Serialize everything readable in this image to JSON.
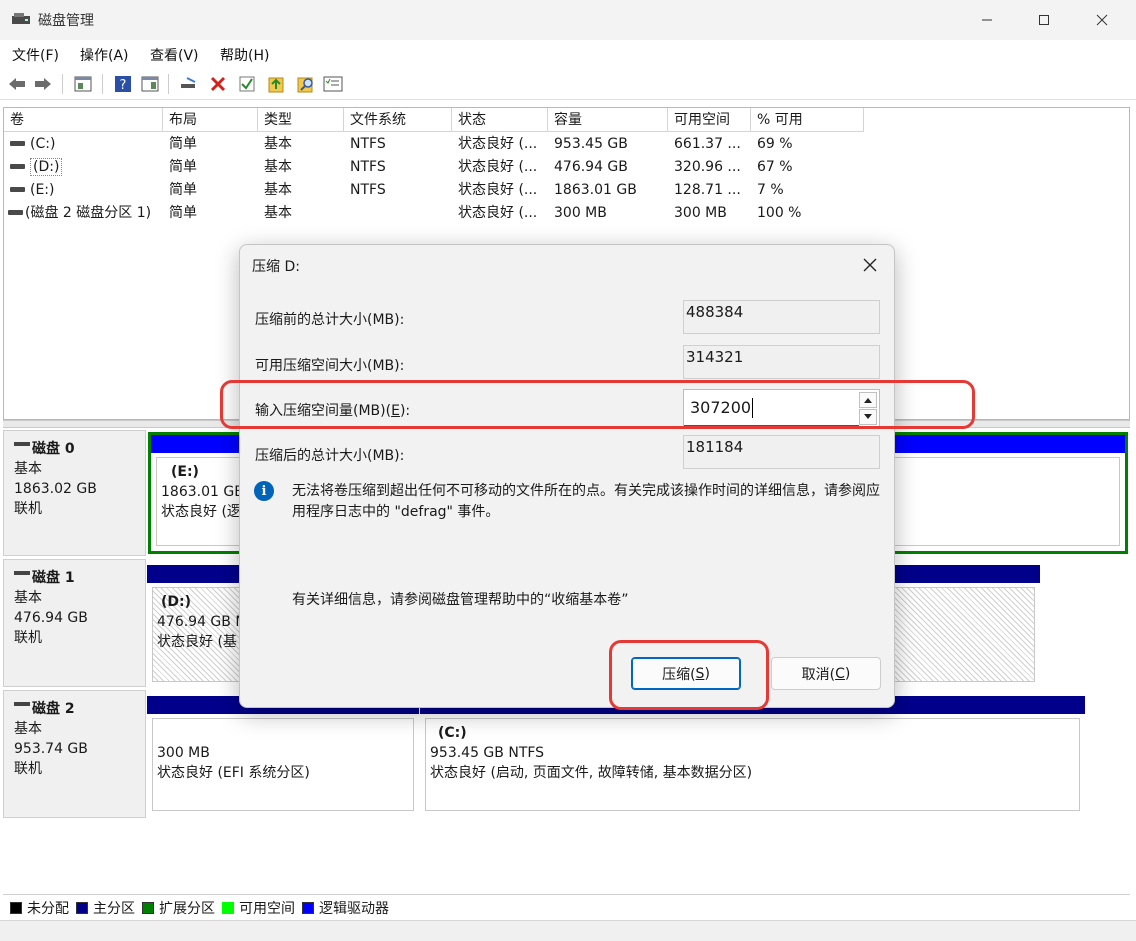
{
  "window": {
    "title": "磁盘管理"
  },
  "menu": [
    "文件(F)",
    "操作(A)",
    "查看(V)",
    "帮助(H)"
  ],
  "toolbar_icons": [
    "back-arrow-icon",
    "forward-arrow-icon",
    "console-tree-icon",
    "help-icon",
    "properties-icon",
    "connect-icon",
    "delete-icon",
    "check-icon",
    "import-icon",
    "search-icon",
    "list-icon"
  ],
  "volume_list": {
    "columns": [
      "卷",
      "布局",
      "类型",
      "文件系统",
      "状态",
      "容量",
      "可用空间",
      "% 可用"
    ],
    "rows": [
      [
        "(C:)",
        "简单",
        "基本",
        "NTFS",
        "状态良好 (...",
        "953.45 GB",
        "661.37 ...",
        "69 %"
      ],
      [
        "(D:)",
        "简单",
        "基本",
        "NTFS",
        "状态良好 (...",
        "476.94 GB",
        "320.96 ...",
        "67 %"
      ],
      [
        "(E:)",
        "简单",
        "基本",
        "NTFS",
        "状态良好 (...",
        "1863.01 GB",
        "128.71 ...",
        "7 %"
      ],
      [
        "(磁盘 2 磁盘分区 1)",
        "简单",
        "基本",
        "",
        "状态良好 (...",
        "300 MB",
        "300 MB",
        "100 %"
      ]
    ]
  },
  "disks": [
    {
      "name": "磁盘 0",
      "type": "基本",
      "size": "1863.02 GB",
      "status": "联机",
      "partitions": [
        {
          "name": "(E:)",
          "size": "1863.01 GE",
          "status": "状态良好 (逻"
        }
      ]
    },
    {
      "name": "磁盘 1",
      "type": "基本",
      "size": "476.94 GB",
      "status": "联机",
      "partitions": [
        {
          "name": "(D:)",
          "size": "476.94 GB N",
          "status": "状态良好 (基"
        }
      ]
    },
    {
      "name": "磁盘 2",
      "type": "基本",
      "size": "953.74 GB",
      "status": "联机",
      "partitions": [
        {
          "name": "",
          "size": "300 MB",
          "status": "状态良好 (EFI 系统分区)"
        },
        {
          "name": "(C:)",
          "size": "953.45 GB NTFS",
          "status": "状态良好 (启动, 页面文件, 故障转储, 基本数据分区)"
        }
      ]
    }
  ],
  "legend": [
    {
      "label": "未分配",
      "color": "#000000"
    },
    {
      "label": "主分区",
      "color": "#00008b"
    },
    {
      "label": "扩展分区",
      "color": "#008000"
    },
    {
      "label": "可用空间",
      "color": "#00ff00"
    },
    {
      "label": "逻辑驱动器",
      "color": "#0000ff"
    }
  ],
  "dialog": {
    "title": "压缩 D:",
    "total_before_label": "压缩前的总计大小(MB):",
    "total_before_value": "488384",
    "available_label": "可用压缩空间大小(MB):",
    "available_value": "314321",
    "input_label_text": "输入压缩空间量(MB)(",
    "input_label_key": "E",
    "input_label_tail": "):",
    "input_value": "307200",
    "total_after_label": "压缩后的总计大小(MB):",
    "total_after_value": "181184",
    "info_message": "无法将卷压缩到超出任何不可移动的文件所在的点。有关完成该操作时间的详细信息，请参阅应用程序日志中的 \"defrag\" 事件。",
    "help_text": "有关详细信息，请参阅磁盘管理帮助中的“收缩基本卷”",
    "shrink_text": "压缩(",
    "shrink_key": "S",
    "shrink_tail": ")",
    "cancel_text": "取消(",
    "cancel_key": "C",
    "cancel_tail": ")"
  },
  "colors": {
    "primary_partition": "#00008b",
    "extended_outline": "#008000",
    "highlight": "#e53935",
    "accent": "#0067c0"
  }
}
